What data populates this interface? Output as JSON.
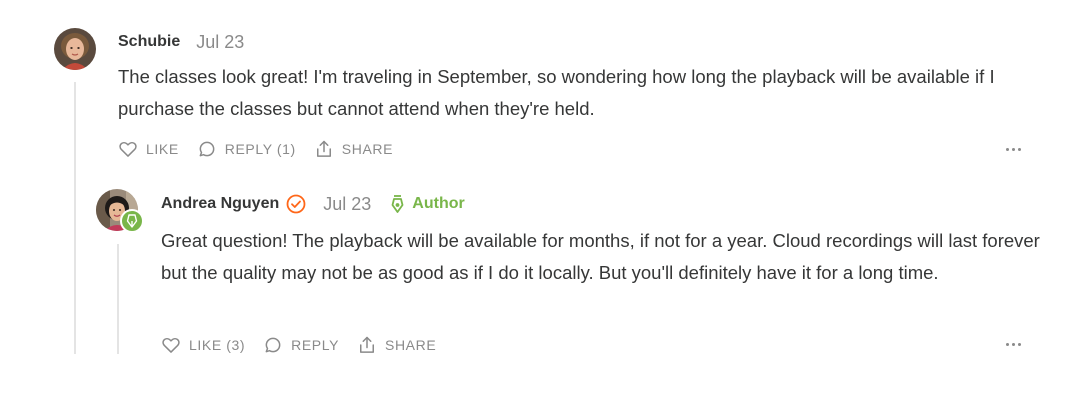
{
  "comments": [
    {
      "author": "Schubie",
      "date": "Jul 23",
      "body": "The classes look great! I'm traveling in September, so wondering how long the playback will be available if I purchase the classes but cannot attend when they're held.",
      "actions": {
        "like": "LIKE",
        "reply": "REPLY (1)",
        "share": "SHARE"
      },
      "avatar_icon": "user-photo"
    },
    {
      "author": "Andrea Nguyen",
      "date": "Jul 23",
      "author_label": "Author",
      "body": "Great question! The playback will be available for months, if not for a year. Cloud recordings will last forever but the quality may not be as good as if I do it locally. But you'll definitely have it for a long time.",
      "actions": {
        "like": "LIKE (3)",
        "reply": "REPLY",
        "share": "SHARE"
      },
      "avatar_icon": "user-photo",
      "verified_icon": "check-circle-icon",
      "author_icon": "pen-nib-icon"
    }
  ],
  "colors": {
    "text": "#363737",
    "muted": "#8a8a8a",
    "author_green": "#79b64a",
    "verified_orange": "#ff6719",
    "thread_line": "#e4e4e4"
  }
}
